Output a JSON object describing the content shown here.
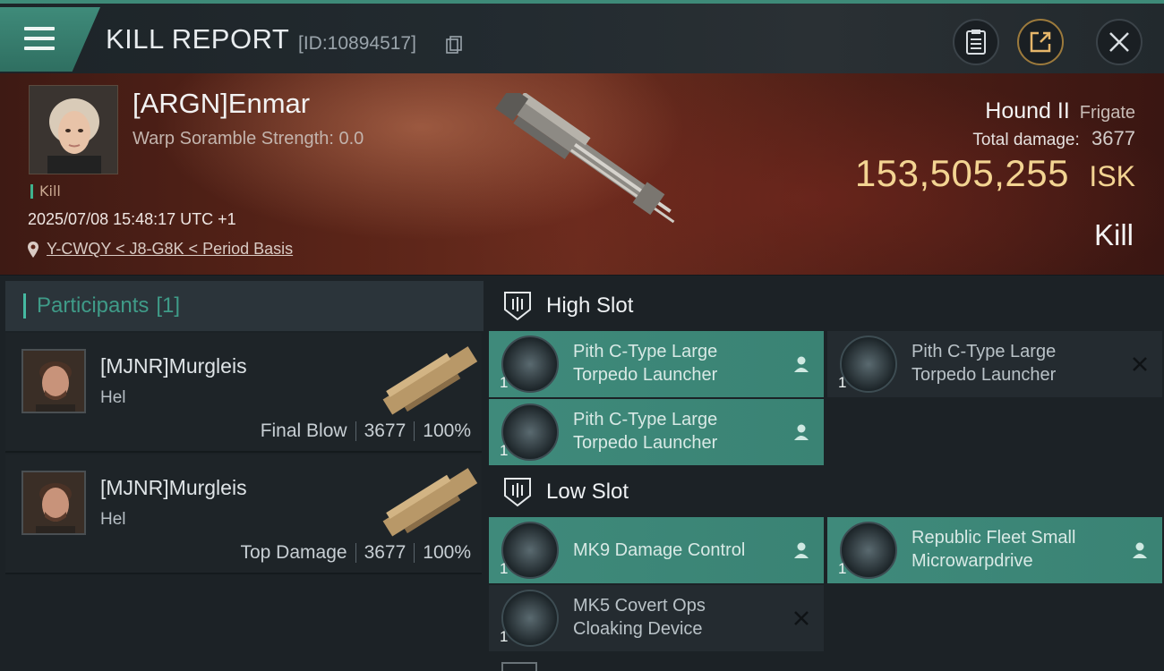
{
  "header": {
    "title": "KILL REPORT",
    "report_id": "[ID:10894517]"
  },
  "victim": {
    "name": "[ARGN]Enmar",
    "scramble": "Warp Soramble Strength: 0.0",
    "tag": "Kill",
    "datetime": "2025/07/08 15:48:17 UTC +1",
    "location": "Y-CWQY < J8-G8K < Period Basis",
    "ship_name": "Hound II",
    "ship_class": "Frigate",
    "total_damage_label": "Total damage:",
    "total_damage": "3677",
    "isk_value": "153,505,255",
    "isk_unit": "ISK",
    "result": "Kill"
  },
  "participants": {
    "label": "Participants",
    "count": "[1]",
    "items": [
      {
        "name": "[MJNR]Murgleis",
        "ship": "Hel",
        "role": "Final Blow",
        "damage": "3677",
        "percent": "100%"
      },
      {
        "name": "[MJNR]Murgleis",
        "ship": "Hel",
        "role": "Top Damage",
        "damage": "3677",
        "percent": "100%"
      }
    ]
  },
  "slots": {
    "high": {
      "label": "High Slot",
      "modules": [
        {
          "name": "Pith C-Type Large Torpedo Launcher",
          "qty": "1",
          "state": "dropped"
        },
        {
          "name": "Pith C-Type Large Torpedo Launcher",
          "qty": "1",
          "state": "destroyed"
        },
        {
          "name": "Pith C-Type Large Torpedo Launcher",
          "qty": "1",
          "state": "dropped"
        }
      ]
    },
    "low": {
      "label": "Low Slot",
      "modules": [
        {
          "name": "MK9 Damage Control",
          "qty": "1",
          "state": "dropped"
        },
        {
          "name": "Republic Fleet Small Microwarpdrive",
          "qty": "1",
          "state": "dropped"
        },
        {
          "name": "MK5 Covert Ops Cloaking Device",
          "qty": "1",
          "state": "destroyed"
        }
      ]
    }
  },
  "colors": {
    "accent": "#3f8b7a",
    "isk": "#f3d492",
    "banner": "#5a2418"
  },
  "icons": [
    "menu-icon",
    "copy-icon",
    "clipboard-icon",
    "share-icon",
    "close-icon",
    "location-pin-icon",
    "slot-shield-icon",
    "pilot-icon",
    "destroyed-x-icon"
  ]
}
